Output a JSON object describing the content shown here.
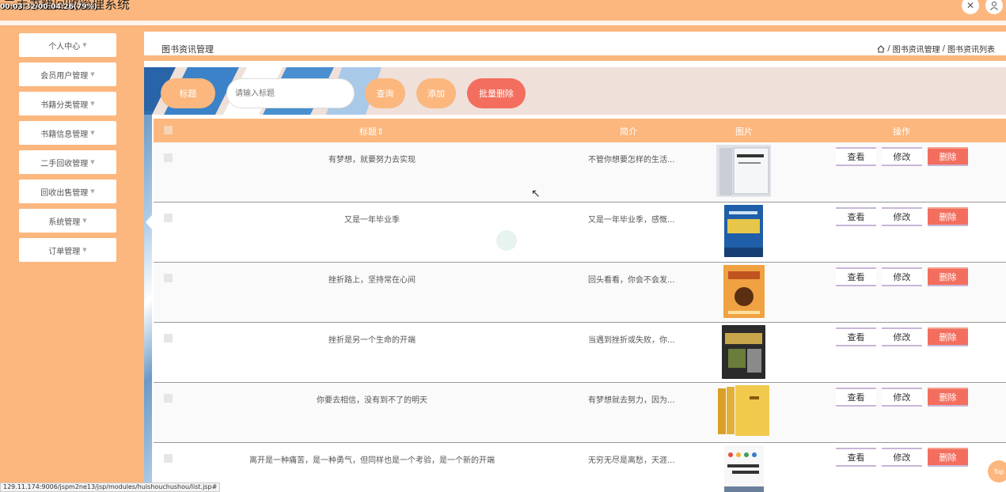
{
  "app": {
    "title": "二手书籍回收管理系统",
    "overlay_time": "00:03:32/00:04:26(79%)"
  },
  "topbar": {
    "close_icon": "close-icon",
    "user_icon": "user-icon"
  },
  "sidebar": {
    "items": [
      {
        "label": "个人中心"
      },
      {
        "label": "会员用户管理"
      },
      {
        "label": "书籍分类管理"
      },
      {
        "label": "书籍信息管理"
      },
      {
        "label": "二手回收管理"
      },
      {
        "label": "回收出售管理"
      },
      {
        "label": "系统管理"
      },
      {
        "label": "订单管理"
      }
    ]
  },
  "header": {
    "title": "图书资讯管理",
    "breadcrumb": [
      "图书资讯管理",
      "图书资讯列表"
    ],
    "separator": "/"
  },
  "search": {
    "label": "标题",
    "placeholder": "请输入标题",
    "query_button": "查询",
    "add_button": "添加",
    "batch_delete_button": "批量删除"
  },
  "table": {
    "columns": [
      "标题",
      "简介",
      "图片",
      "操作"
    ],
    "sort_indicator": "⇕",
    "actions": {
      "view": "查看",
      "edit": "修改",
      "delete": "删除"
    },
    "rows": [
      {
        "title": "有梦想，就要努力去实现",
        "intro": "不管你想要怎样的生活..."
      },
      {
        "title": "又是一年毕业季",
        "intro": "又是一年毕业季，感慨..."
      },
      {
        "title": "挫折路上，坚持常在心间",
        "intro": "回头看看，你会不会发..."
      },
      {
        "title": "挫折是另一个生命的开端",
        "intro": "当遇到挫折或失败，你..."
      },
      {
        "title": "你要去相信，没有到不了的明天",
        "intro": "有梦想就去努力，因为..."
      },
      {
        "title": "离开是一种痛苦，是一种勇气，但同样也是一个考验，是一个新的开端",
        "intro": "无穷无尽是离愁，天涯..."
      }
    ]
  },
  "statusbar": {
    "url": "129.11.174:9006/jspm2ne13/jsp/modules/huishouchushou/list.jsp#"
  },
  "back_to_top": "Top",
  "colors": {
    "accent": "#fbb77e",
    "danger": "#f36e5e",
    "header_bg": "#fff"
  }
}
